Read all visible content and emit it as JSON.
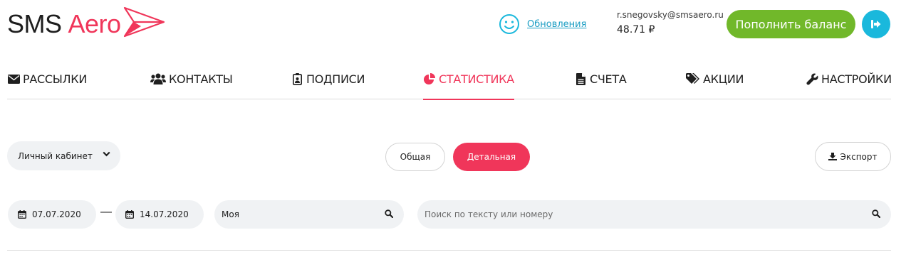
{
  "brand": {
    "part1": "SMS",
    "part2": "Aero",
    "accent": "#f0365a"
  },
  "header": {
    "updates_icon": "smiley-icon",
    "updates_label": "Обновления",
    "email": "r.snegovsky@smsaero.ru",
    "balance": "48.71 ₽",
    "topup_label": "Пополнить баланс",
    "topup_color": "#71b82a",
    "logout_icon": "logout-icon",
    "logout_color": "#1ab8dc"
  },
  "nav": {
    "items": [
      {
        "label": "РАССЫЛКИ",
        "icon": "envelope-icon"
      },
      {
        "label": "КОНТАКТЫ",
        "icon": "users-icon"
      },
      {
        "label": "ПОДПИСИ",
        "icon": "id-badge-icon"
      },
      {
        "label": "СТАТИСТИКА",
        "icon": "pie-chart-icon",
        "active": true
      },
      {
        "label": "СЧЕТА",
        "icon": "file-icon"
      },
      {
        "label": "АКЦИИ",
        "icon": "tags-icon"
      },
      {
        "label": "НАСТРОЙКИ",
        "icon": "wrench-icon"
      }
    ]
  },
  "controls": {
    "cabinet_selected": "Личный кабинет",
    "tab_general": "Общая",
    "tab_detail": "Детальная",
    "export_label": "Экспорт"
  },
  "filters": {
    "date_from": "07.07.2020",
    "date_separator": "—",
    "date_to": "14.07.2020",
    "sender_value": "Моя",
    "search_placeholder": "Поиск по тексту или номеру"
  }
}
